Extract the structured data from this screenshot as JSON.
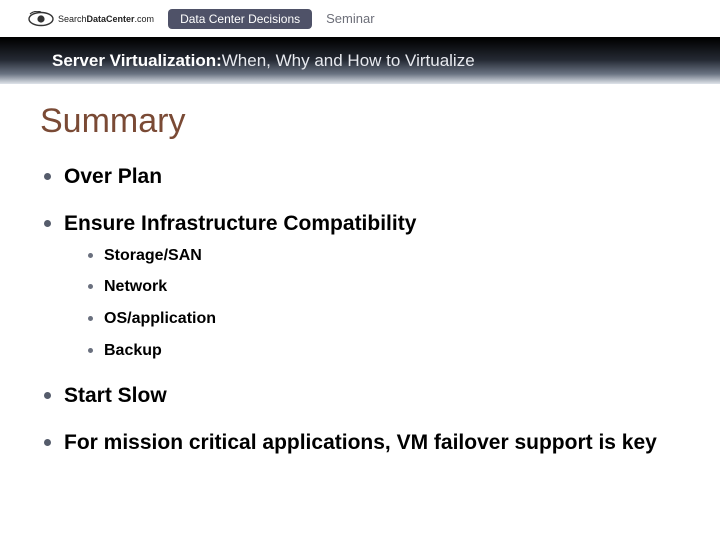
{
  "topband": {
    "logo_text_prefix": "Search",
    "logo_text_mid": "DataCenter",
    "logo_text_suffix": ".com",
    "pill": "Data Center Decisions",
    "seminar": "Seminar"
  },
  "subtitle": {
    "strong": "Server Virtualization:",
    "rest": " When, Why and How to Virtualize"
  },
  "heading": "Summary",
  "bullets": [
    {
      "text": "Over Plan"
    },
    {
      "text": "Ensure Infrastructure Compatibility",
      "sub": [
        "Storage/SAN",
        "Network",
        "OS/application",
        "Backup"
      ]
    },
    {
      "text": "Start Slow"
    },
    {
      "text": "For mission critical applications, VM failover support is key"
    }
  ]
}
